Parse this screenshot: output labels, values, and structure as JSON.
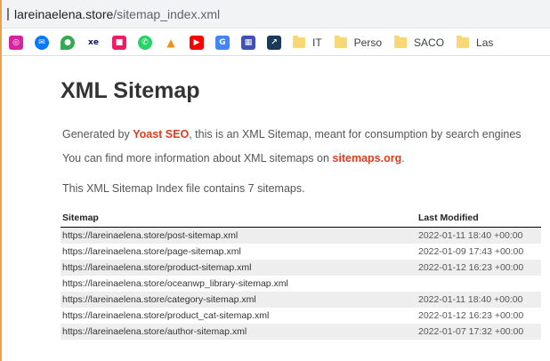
{
  "browser": {
    "url_host": "lareinaelena.store",
    "url_path": "/sitemap_index.xml"
  },
  "bookmarks": {
    "icons": [
      {
        "name": "instagram-icon",
        "color": "#d6249f",
        "glyph": "◎"
      },
      {
        "name": "messenger-icon",
        "color": "#0078ff",
        "glyph": "✉"
      },
      {
        "name": "maps-pin-icon",
        "color": "#34a853",
        "glyph": "●"
      },
      {
        "name": "xe-icon",
        "color": "#0a146e",
        "glyph": "xe"
      },
      {
        "name": "app-icon",
        "color": "#e91e63",
        "glyph": "■"
      },
      {
        "name": "whatsapp-icon",
        "color": "#25d366",
        "glyph": "✆"
      },
      {
        "name": "pma-icon",
        "color": "#f29111",
        "glyph": "▲"
      },
      {
        "name": "youtube-icon",
        "color": "#ff0000",
        "glyph": "▶"
      },
      {
        "name": "translate-icon",
        "color": "#4285f4",
        "glyph": "G"
      },
      {
        "name": "grid-app-icon",
        "color": "#3f51b5",
        "glyph": "▦"
      },
      {
        "name": "stock-chart-icon",
        "color": "#1a3a5c",
        "glyph": "↗"
      }
    ],
    "folders": [
      "IT",
      "Perso",
      "SACO",
      "Las"
    ]
  },
  "page": {
    "title": "XML Sitemap",
    "generated_prefix": "Generated by ",
    "generated_link": "Yoast SEO",
    "generated_suffix": ", this is an XML Sitemap, meant for consumption by search engines",
    "info_prefix": "You can find more information about XML sitemaps on ",
    "info_link": "sitemaps.org",
    "info_suffix": ".",
    "count_text": "This XML Sitemap Index file contains 7 sitemaps."
  },
  "table": {
    "headers": {
      "sitemap": "Sitemap",
      "last_modified": "Last Modified"
    },
    "rows": [
      {
        "url": "https://lareinaelena.store/post-sitemap.xml",
        "modified": "2022-01-11 18:40 +00:00"
      },
      {
        "url": "https://lareinaelena.store/page-sitemap.xml",
        "modified": "2022-01-09 17:43 +00:00"
      },
      {
        "url": "https://lareinaelena.store/product-sitemap.xml",
        "modified": "2022-01-12 16:23 +00:00"
      },
      {
        "url": "https://lareinaelena.store/oceanwp_library-sitemap.xml",
        "modified": ""
      },
      {
        "url": "https://lareinaelena.store/category-sitemap.xml",
        "modified": "2022-01-11 18:40 +00:00"
      },
      {
        "url": "https://lareinaelena.store/product_cat-sitemap.xml",
        "modified": "2022-01-12 16:23 +00:00"
      },
      {
        "url": "https://lareinaelena.store/author-sitemap.xml",
        "modified": "2022-01-07 17:32 +00:00"
      }
    ]
  }
}
